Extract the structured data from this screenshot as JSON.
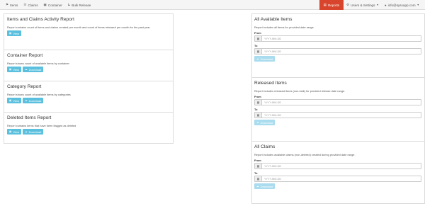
{
  "navbar": {
    "left": [
      {
        "label": "Items",
        "icon": "tag-icon"
      },
      {
        "label": "Claims",
        "icon": "list-icon"
      },
      {
        "label": "Container",
        "icon": "container-icon"
      },
      {
        "label": "Bulk Release",
        "icon": "cart-icon"
      }
    ],
    "reports_label": "Reports",
    "users_settings_label": "Users & Settings",
    "account_label": "info@sysxapp.com"
  },
  "left_reports": [
    {
      "title": "Items and Claims Activity Report",
      "desc": "Report contains count of items and claims created per month and count of items released per month for the past year.",
      "view": "View"
    },
    {
      "title": "Container Report",
      "desc": "Report shows count of available items by container",
      "view": "View",
      "download": "Download"
    },
    {
      "title": "Category Report",
      "desc": "Report shows count of available items by categories",
      "view": "View",
      "download": "Download"
    },
    {
      "title": "Deleted Items Report",
      "desc": "Report contains items that have been flagged as deleted",
      "view": "View",
      "download": "Download"
    }
  ],
  "right_reports": [
    {
      "title": "All Available Items",
      "desc": "Report includes all items for provided date range.",
      "from_label": "From",
      "to_label": "To",
      "placeholder": "YYYY-MM-DD",
      "download": "Download"
    },
    {
      "title": "Released Items",
      "desc": "Report includes released items (non-bulk) for provided release date range.",
      "from_label": "From",
      "to_label": "To",
      "placeholder": "YYYY-MM-DD",
      "download": "Download"
    },
    {
      "title": "All Claims",
      "desc": "Report includes available claims (non-deleted) created during provided date range.",
      "from_label": "From",
      "to_label": "To",
      "placeholder": "YYYY-MM-DD",
      "download": "Download"
    }
  ],
  "colors": {
    "accent": "#d9452c",
    "button": "#5bc0de",
    "button_disabled": "#a9dcee"
  }
}
